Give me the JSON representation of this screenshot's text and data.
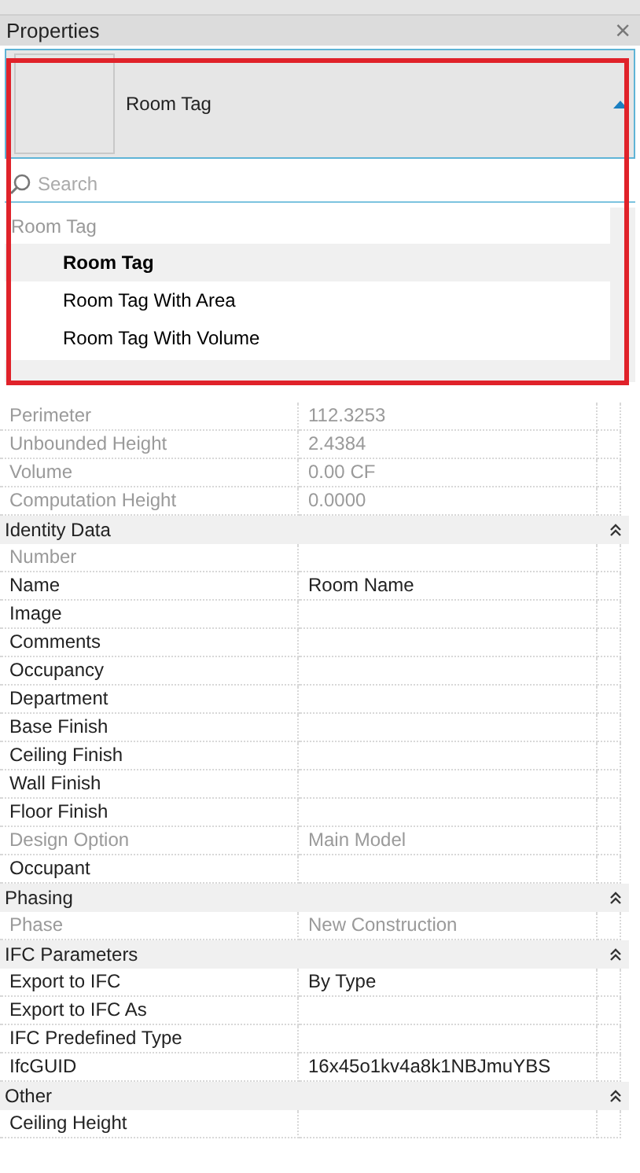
{
  "panel": {
    "title": "Properties",
    "close": "×"
  },
  "type_selector": {
    "label": "Room Tag",
    "expanded": true
  },
  "search": {
    "placeholder": "Search"
  },
  "dropdown": {
    "group": "Room Tag",
    "items": [
      {
        "label": "Room Tag",
        "selected": true
      },
      {
        "label": "Room Tag With Area",
        "selected": false
      },
      {
        "label": "Room Tag With Volume",
        "selected": false
      }
    ]
  },
  "sections": [
    {
      "rows": [
        {
          "label": "Perimeter",
          "value": "112.3253",
          "readonly": true
        },
        {
          "label": "Unbounded Height",
          "value": "2.4384",
          "readonly": true
        },
        {
          "label": "Volume",
          "value": "0.00 CF",
          "readonly": true
        },
        {
          "label": "Computation Height",
          "value": "0.0000",
          "readonly": true
        }
      ]
    },
    {
      "title": "Identity Data",
      "expanded": true,
      "rows": [
        {
          "label": "Number",
          "readonly": true
        },
        {
          "label": "Name",
          "value": "Room Name",
          "readonly": false
        },
        {
          "label": "Image",
          "readonly": false
        },
        {
          "label": "Comments",
          "readonly": false
        },
        {
          "label": "Occupancy",
          "readonly": false
        },
        {
          "label": "Department",
          "readonly": false
        },
        {
          "label": "Base Finish",
          "readonly": false
        },
        {
          "label": "Ceiling Finish",
          "readonly": false
        },
        {
          "label": "Wall Finish",
          "readonly": false
        },
        {
          "label": "Floor Finish",
          "readonly": false
        },
        {
          "label": "Design Option",
          "value": "Main Model",
          "readonly": true
        },
        {
          "label": "Occupant",
          "readonly": false
        }
      ]
    },
    {
      "title": "Phasing",
      "expanded": true,
      "rows": [
        {
          "label": "Phase",
          "value": "New Construction",
          "readonly": true
        }
      ]
    },
    {
      "title": "IFC Parameters",
      "expanded": true,
      "rows": [
        {
          "label": "Export to IFC",
          "value": "By Type",
          "readonly": false
        },
        {
          "label": "Export to IFC As",
          "readonly": false
        },
        {
          "label": "IFC Predefined Type",
          "readonly": false
        },
        {
          "label": "IfcGUID",
          "value": "16x45o1kv4a8k1NBJmuYBS",
          "readonly": false
        }
      ]
    },
    {
      "title": "Other",
      "expanded": true,
      "rows": [
        {
          "label": "Ceiling Height",
          "readonly": false
        }
      ]
    }
  ]
}
